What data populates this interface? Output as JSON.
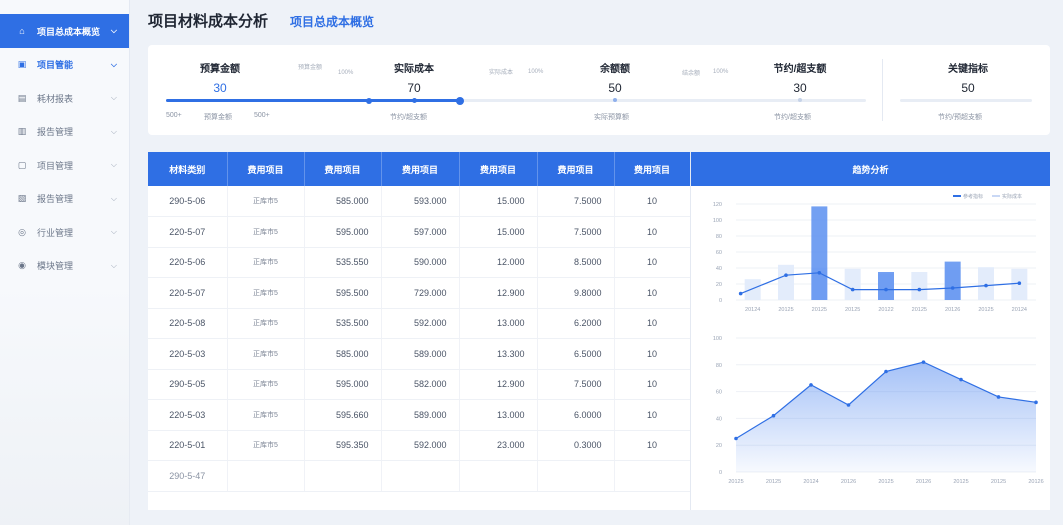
{
  "sidebar": {
    "items": [
      {
        "label": "项目总成本概览",
        "icon": "home-icon",
        "key": "overview"
      },
      {
        "label": "项目管能",
        "icon": "folder-icon",
        "key": "project"
      },
      {
        "label": "耗材报表",
        "icon": "report-icon",
        "key": "consumables"
      },
      {
        "label": "报告管理",
        "icon": "document-icon",
        "key": "report1"
      },
      {
        "label": "项目管理",
        "icon": "chat-icon",
        "key": "project-mgmt"
      },
      {
        "label": "报告管理",
        "icon": "image-icon",
        "key": "report2"
      },
      {
        "label": "行业管理",
        "icon": "compass-icon",
        "key": "industry"
      },
      {
        "label": "模块管理",
        "icon": "settings-icon",
        "key": "module"
      }
    ]
  },
  "header": {
    "title": "项目材料成本分析",
    "subtab": "项目总成本概览"
  },
  "kpi": {
    "items": [
      {
        "label": "预算金额",
        "value": "30"
      },
      {
        "label": "实际成本",
        "value": "70"
      },
      {
        "label": "余额额",
        "value": "50"
      },
      {
        "label": "节约/超支额",
        "value": "30"
      },
      {
        "label": "关键指标",
        "value": "50"
      }
    ],
    "tiny": [
      "预算金额",
      "100%",
      "实际成本",
      "100%",
      "结余额",
      "100%"
    ],
    "sub": [
      "500+",
      "预算金额",
      "500+",
      "节约/超支额",
      "实际预算额",
      "节约/超支额",
      "节约/预超支额"
    ],
    "progress": {
      "budget": 0.29,
      "overall": 0.42
    }
  },
  "table": {
    "columns": [
      "材料类别",
      "费用项目",
      "费用项目",
      "费用项目",
      "费用项目",
      "费用项目",
      "费用项目"
    ],
    "rows": [
      [
        "290-5-06",
        "正库市5",
        "585.000",
        "593.000",
        "15.000",
        "7.5000",
        "10"
      ],
      [
        "220-5-07",
        "正库市5",
        "595.000",
        "597.000",
        "15.000",
        "7.5000",
        "10"
      ],
      [
        "220-5-06",
        "正库市5",
        "535.550",
        "590.000",
        "12.000",
        "8.5000",
        "10"
      ],
      [
        "220-5-07",
        "正库市5",
        "595.500",
        "729.000",
        "12.900",
        "9.8000",
        "10"
      ],
      [
        "220-5-08",
        "正库市5",
        "535.500",
        "592.000",
        "13.000",
        "6.2000",
        "10"
      ],
      [
        "220-5-03",
        "正库市5",
        "585.000",
        "589.000",
        "13.300",
        "6.5000",
        "10"
      ],
      [
        "290-5-05",
        "正库市5",
        "595.000",
        "582.000",
        "12.900",
        "7.5000",
        "10"
      ],
      [
        "220-5-03",
        "正库市5",
        "595.660",
        "589.000",
        "13.000",
        "6.0000",
        "10"
      ],
      [
        "220-5-01",
        "正库市5",
        "595.350",
        "592.000",
        "23.000",
        "0.3000",
        "10"
      ],
      [
        "290-5-47",
        "",
        "",
        "",
        "",
        "",
        ""
      ]
    ]
  },
  "trend": {
    "title": "趋势分析",
    "legend": [
      "参考指标",
      "实际成本"
    ]
  },
  "chart_data": [
    {
      "type": "bar",
      "categories": [
        "20124",
        "20125",
        "20125",
        "20125",
        "20122",
        "20125",
        "20126",
        "20125",
        "20124"
      ],
      "series": [
        {
          "name": "实际成本",
          "values": [
            26,
            44,
            40,
            39,
            33,
            35,
            38,
            41,
            39
          ]
        },
        {
          "name": "参考指标",
          "values": [
            0,
            0,
            117,
            0,
            35,
            0,
            48,
            0,
            0
          ]
        }
      ],
      "line": [
        8,
        31,
        34,
        13,
        13,
        13,
        15,
        18,
        21
      ],
      "yticks": [
        0,
        20,
        40,
        60,
        80,
        100,
        120
      ],
      "ylim": [
        0,
        120
      ]
    },
    {
      "type": "area",
      "categories": [
        "20125",
        "20125",
        "20124",
        "20126",
        "20125",
        "20126",
        "20125",
        "20125",
        "20126"
      ],
      "values": [
        25,
        42,
        65,
        50,
        75,
        82,
        69,
        56,
        52
      ],
      "yticks": [
        0,
        20,
        40,
        60,
        80,
        100
      ],
      "ylim": [
        0,
        100
      ]
    }
  ]
}
